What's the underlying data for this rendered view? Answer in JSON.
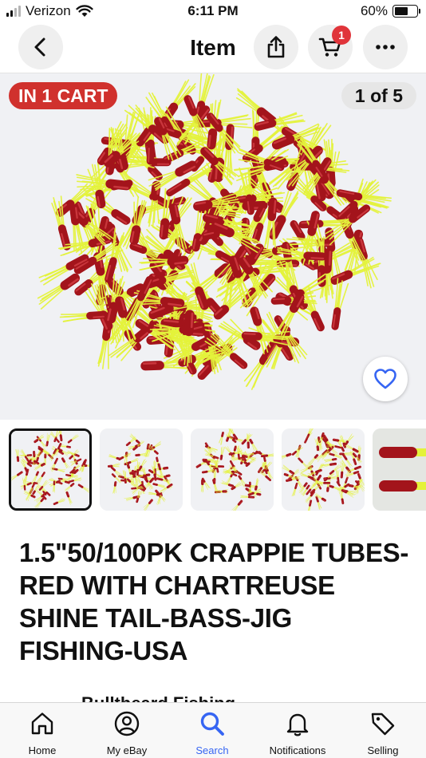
{
  "status_bar": {
    "carrier": "Verizon",
    "time": "6:11 PM",
    "battery_percent": "60%",
    "battery_level": 0.6,
    "signal_bars_active": 2
  },
  "nav": {
    "title": "Item",
    "cart_count": "1",
    "icons": {
      "back": "chevron-left-icon",
      "share": "share-icon",
      "cart": "cart-icon",
      "more": "more-icon"
    }
  },
  "gallery": {
    "cart_tag": "IN 1 CART",
    "counter": "1 of 5",
    "watch_icon": "heart-icon",
    "thumbnails_count": 5,
    "selected_index": 0
  },
  "item": {
    "title": "1.5\"50/100PK CRAPPIE TUBES-RED WITH CHARTREUSE SHINE TAIL-BASS-JIG FISHING-USA"
  },
  "seller": {
    "name_partial": "Bulltheard Fishing"
  },
  "tab_bar": {
    "tabs": [
      {
        "label": "Home",
        "icon": "home-icon",
        "active": false
      },
      {
        "label": "My eBay",
        "icon": "profile-icon",
        "active": false
      },
      {
        "label": "Search",
        "icon": "search-icon",
        "active": true
      },
      {
        "label": "Notifications",
        "icon": "bell-icon",
        "active": false
      },
      {
        "label": "Selling",
        "icon": "tag-icon",
        "active": false
      }
    ]
  },
  "colors": {
    "accent": "#3665f3",
    "cart_tag": "#d0312d",
    "badge": "#e0343a",
    "lure_red": "#a3141b",
    "lure_chartreuse": "#e4f23a"
  }
}
